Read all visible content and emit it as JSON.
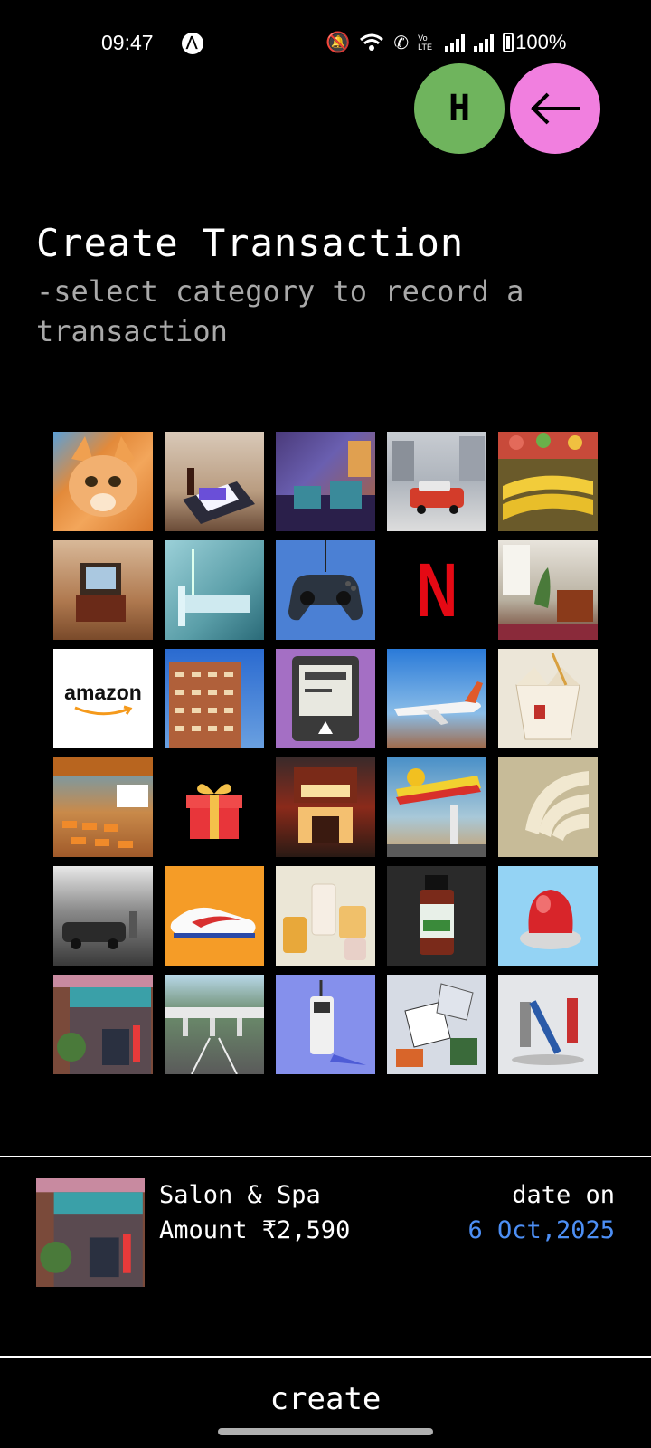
{
  "status_bar": {
    "time": "09:47",
    "battery": "100%",
    "volte": "Vo LTE"
  },
  "header": {
    "avatar_letter": "H",
    "back_icon": "arrow-left-icon"
  },
  "title": "Create Transaction",
  "subtitle": "-select category to record a transaction",
  "categories": [
    {
      "name": "cat-pet",
      "icon": "cat-icon"
    },
    {
      "name": "fast-food",
      "icon": "burger-tray-icon"
    },
    {
      "name": "cafe-lounge",
      "icon": "lounge-icon"
    },
    {
      "name": "taxi",
      "icon": "taxi-icon"
    },
    {
      "name": "groceries",
      "icon": "banana-icon"
    },
    {
      "name": "tv-home",
      "icon": "television-icon"
    },
    {
      "name": "hospital",
      "icon": "hospital-bed-icon"
    },
    {
      "name": "gaming",
      "icon": "gamepad-icon"
    },
    {
      "name": "netflix",
      "icon": "netflix-icon",
      "label": "N"
    },
    {
      "name": "home-office",
      "icon": "room-icon"
    },
    {
      "name": "amazon",
      "icon": "amazon-icon",
      "label": "amazon"
    },
    {
      "name": "rent-building",
      "icon": "building-icon"
    },
    {
      "name": "electricity",
      "icon": "meter-icon"
    },
    {
      "name": "flight",
      "icon": "airplane-icon"
    },
    {
      "name": "chinese-food",
      "icon": "takeout-box-icon"
    },
    {
      "name": "education",
      "icon": "classroom-icon"
    },
    {
      "name": "gift",
      "icon": "gift-icon"
    },
    {
      "name": "movies",
      "icon": "theater-icon"
    },
    {
      "name": "fuel",
      "icon": "fuel-station-icon"
    },
    {
      "name": "wifi",
      "icon": "wifi-icon"
    },
    {
      "name": "car-service",
      "icon": "garage-icon"
    },
    {
      "name": "shoes",
      "icon": "sneaker-icon"
    },
    {
      "name": "cosmetics",
      "icon": "perfume-icon"
    },
    {
      "name": "medicine",
      "icon": "medicine-bottle-icon"
    },
    {
      "name": "emergency",
      "icon": "siren-icon"
    },
    {
      "name": "salon-spa",
      "icon": "salon-icon"
    },
    {
      "name": "toll",
      "icon": "toll-plaza-icon"
    },
    {
      "name": "mobile-phone",
      "icon": "phone-icon"
    },
    {
      "name": "miscellaneous",
      "icon": "collage-icon"
    },
    {
      "name": "transport-signal",
      "icon": "traffic-light-icon"
    }
  ],
  "selection": {
    "category": "Salon & Spa",
    "amount": "Amount ₹2,590",
    "date_label": "date on",
    "date": "6 Oct,2025"
  },
  "actions": {
    "create_label": "create"
  },
  "colors": {
    "avatar": "#6fb45d",
    "back_button": "#f17fdf",
    "date": "#4d8ff5"
  }
}
